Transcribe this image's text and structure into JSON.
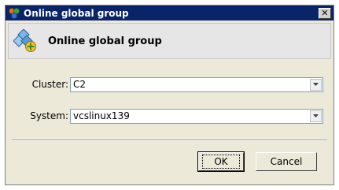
{
  "window": {
    "title": "Online global group",
    "close_glyph": "✕",
    "title_icon": "global-group-icon"
  },
  "header": {
    "title": "Online global group",
    "icon": "global-group-add-icon"
  },
  "form": {
    "cluster_label": "Cluster:",
    "cluster_value": "C2",
    "system_label": "System:",
    "system_value": "vcslinux139"
  },
  "buttons": {
    "ok_label": "OK",
    "cancel_label": "Cancel"
  },
  "colors": {
    "titlebar": "#0a246a",
    "dialog_bg": "#ece9d8",
    "combo_border": "#7f9db9"
  }
}
